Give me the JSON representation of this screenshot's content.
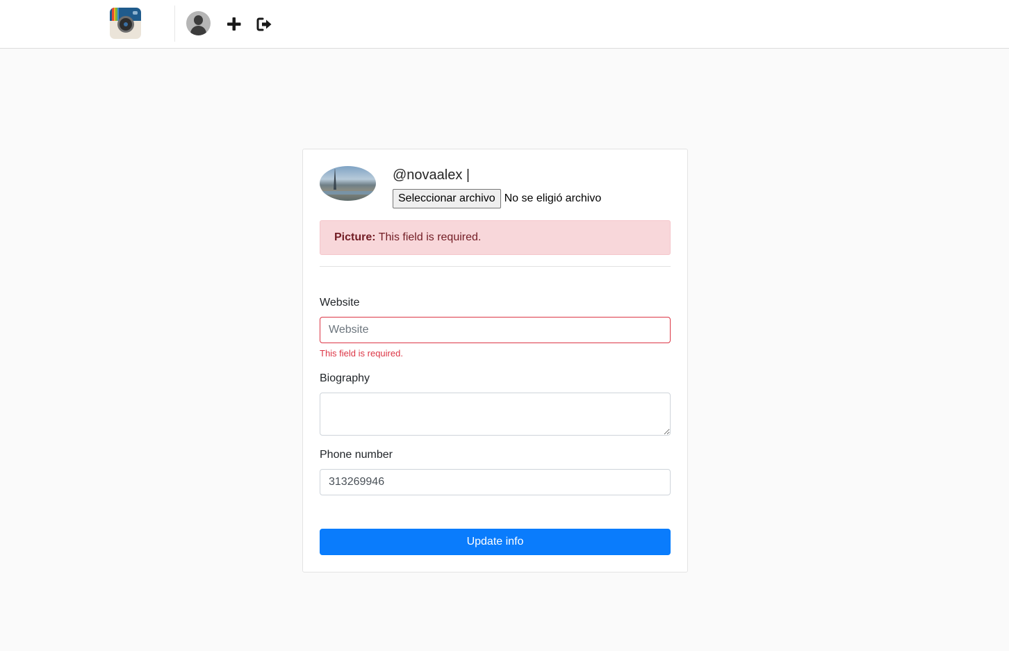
{
  "nav": {
    "logo_icon": "camera-app-logo-icon",
    "profile_icon": "user-avatar-icon",
    "new_post_icon": "plus-icon",
    "logout_icon": "sign-out-icon"
  },
  "profile": {
    "username": "@novaalex |",
    "picture_icon": "profile-picture",
    "file_button_label": "Seleccionar archivo",
    "file_status": "No se eligió archivo"
  },
  "alert": {
    "field": "Picture:",
    "message": "This field is required."
  },
  "form": {
    "website": {
      "label": "Website",
      "placeholder": "Website",
      "value": "",
      "error": "This field is required."
    },
    "biography": {
      "label": "Biography",
      "value": ""
    },
    "phone": {
      "label": "Phone number",
      "value": "313269946"
    },
    "submit_label": "Update info"
  },
  "colors": {
    "primary": "#007bff",
    "danger": "#dc3545",
    "alert_bg": "#f8d7da",
    "alert_text": "#721c24",
    "page_bg": "#fafafa"
  }
}
